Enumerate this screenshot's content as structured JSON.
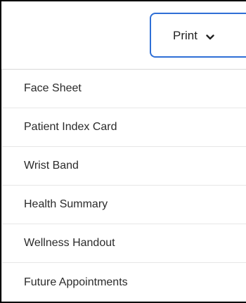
{
  "print_button": {
    "label": "Print",
    "icon": "chevron-down-icon",
    "border_color": "#2f6fd6"
  },
  "menu": {
    "items": [
      {
        "label": "Face Sheet"
      },
      {
        "label": "Patient Index Card"
      },
      {
        "label": "Wrist Band"
      },
      {
        "label": "Health Summary"
      },
      {
        "label": "Wellness Handout"
      },
      {
        "label": "Future Appointments"
      }
    ]
  }
}
